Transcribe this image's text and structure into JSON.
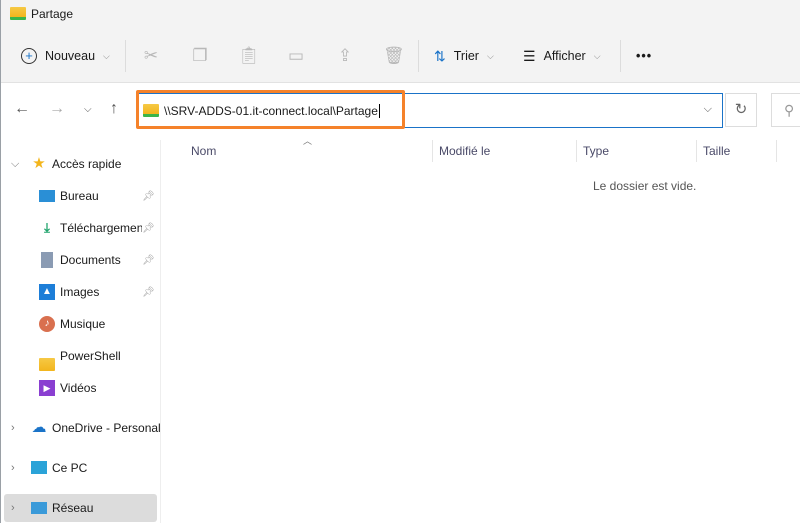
{
  "window": {
    "title": "Partage"
  },
  "toolbar": {
    "new_label": "Nouveau",
    "sort_label": "Trier",
    "view_label": "Afficher",
    "more_label": "•••"
  },
  "address": {
    "path": "\\\\SRV-ADDS-01.it-connect.local\\Partage"
  },
  "columns": [
    "Nom",
    "Modifié le",
    "Type",
    "Taille"
  ],
  "empty_message": "Le dossier est vide.",
  "sidebar": {
    "quick_access": "Accès rapide",
    "quick_items": [
      {
        "label": "Bureau",
        "pinned": true
      },
      {
        "label": "Téléchargements",
        "pinned": true
      },
      {
        "label": "Documents",
        "pinned": true
      },
      {
        "label": "Images",
        "pinned": true
      },
      {
        "label": "Musique",
        "pinned": false
      },
      {
        "label": "PowerShell",
        "pinned": false
      },
      {
        "label": "Vidéos",
        "pinned": false
      }
    ],
    "onedrive": "OneDrive - Personal",
    "this_pc": "Ce PC",
    "network": "Réseau"
  },
  "colors": {
    "highlight": "#f5822a",
    "accent": "#1a73c8"
  }
}
